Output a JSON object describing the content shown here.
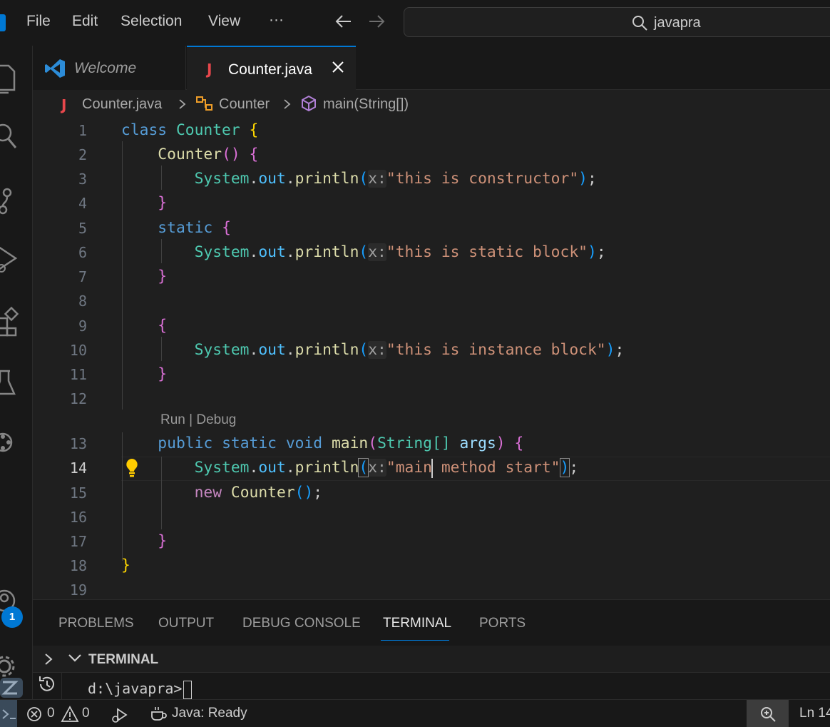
{
  "menu": {
    "file": "File",
    "edit": "Edit",
    "selection": "Selection",
    "view": "View",
    "more": "···"
  },
  "search": {
    "text": "javapra"
  },
  "activity": {
    "badge_count": "1"
  },
  "tabs": [
    {
      "label": "Welcome"
    },
    {
      "label": "Counter.java"
    }
  ],
  "breadcrumb": {
    "file": "Counter.java",
    "class": "Counter",
    "method": "main(String[])"
  },
  "codelens": "Run | Debug",
  "code": {
    "line_numbers": [
      "1",
      "2",
      "3",
      "4",
      "5",
      "6",
      "7",
      "8",
      "9",
      "10",
      "11",
      "12",
      "13",
      "14",
      "15",
      "16",
      "17",
      "18",
      "19"
    ],
    "l1": {
      "kw": "class",
      "cls": "Counter",
      "open": "{"
    },
    "l2": {
      "fn": "Counter",
      "paren": "()",
      "open": "{"
    },
    "l3": {
      "obj": "System",
      "dot1": ".",
      "prop": "out",
      "dot2": ".",
      "fn": "println",
      "lp": "(",
      "hint": "x:",
      "str": "\"this is constructor\"",
      "rp": ")",
      "semi": ";"
    },
    "l4": {
      "close": "}"
    },
    "l5": {
      "kw": "static",
      "open": "{"
    },
    "l6": {
      "obj": "System",
      "dot1": ".",
      "prop": "out",
      "dot2": ".",
      "fn": "println",
      "lp": "(",
      "hint": "x:",
      "str": "\"this is static block\"",
      "rp": ")",
      "semi": ";"
    },
    "l7": {
      "close": "}"
    },
    "l9": {
      "open": "{"
    },
    "l10": {
      "obj": "System",
      "dot1": ".",
      "prop": "out",
      "dot2": ".",
      "fn": "println",
      "lp": "(",
      "hint": "x:",
      "str": "\"this is instance block\"",
      "rp": ")",
      "semi": ";"
    },
    "l11": {
      "close": "}"
    },
    "l13": {
      "kw1": "public",
      "kw2": "static",
      "kw3": "void",
      "fn": "main",
      "lp": "(",
      "type": "String[]",
      "arg": "args",
      "rp": ")",
      "open": "{"
    },
    "l14": {
      "obj": "System",
      "dot1": ".",
      "prop": "out",
      "dot2": ".",
      "fn": "println",
      "lp": "(",
      "hint": "x:",
      "str_a": "\"main",
      "str_b": " method start\"",
      "rp": ")",
      "semi": ";"
    },
    "l15": {
      "kw": "new",
      "cls": "Counter",
      "paren": "()",
      "semi": ";"
    },
    "l17": {
      "close": "}"
    },
    "l18": {
      "close": "}"
    }
  },
  "panel": {
    "tabs": [
      "PROBLEMS",
      "OUTPUT",
      "DEBUG CONSOLE",
      "TERMINAL",
      "PORTS"
    ],
    "terminal_title": "TERMINAL",
    "prompt": "d:\\javapra>"
  },
  "status": {
    "errors": "0",
    "warnings": "0",
    "java": "Java: Ready",
    "position": "Ln 14"
  },
  "colors": {
    "accent": "#0078d4",
    "java_icon": "#e8474c",
    "background": "#1f1f1f",
    "chrome": "#181818"
  }
}
